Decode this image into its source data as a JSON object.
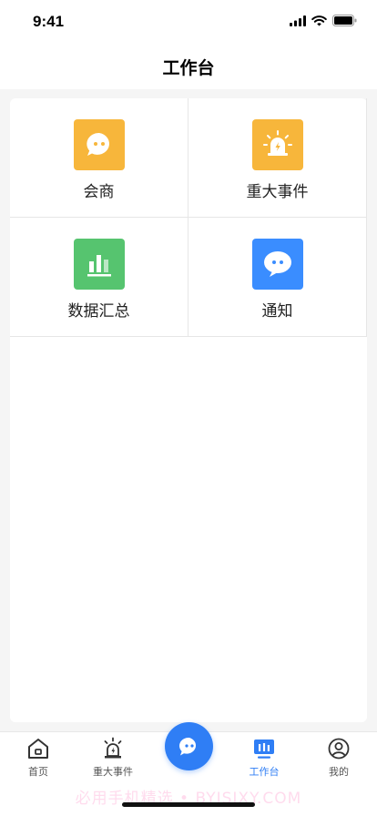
{
  "status_bar": {
    "time": "9:41"
  },
  "header": {
    "title": "工作台"
  },
  "grid": {
    "items": [
      {
        "label": "会商",
        "icon": "chat-bubble-icon",
        "color": "#f7b63b"
      },
      {
        "label": "重大事件",
        "icon": "alarm-light-icon",
        "color": "#f7b63b"
      },
      {
        "label": "数据汇总",
        "icon": "bar-chart-icon",
        "color": "#56c46f"
      },
      {
        "label": "通知",
        "icon": "message-icon",
        "color": "#3a8dff"
      }
    ]
  },
  "tabbar": {
    "tabs": [
      {
        "label": "首页",
        "icon": "home-icon"
      },
      {
        "label": "重大事件",
        "icon": "alarm-light-icon"
      },
      {
        "label": "工作台",
        "icon": "monitor-icon",
        "active": true
      },
      {
        "label": "我的",
        "icon": "user-icon"
      }
    ],
    "center_icon": "chat-icon",
    "accent": "#2f7ef5"
  },
  "watermark": "必用手机精选 • BYJSJXY.COM"
}
